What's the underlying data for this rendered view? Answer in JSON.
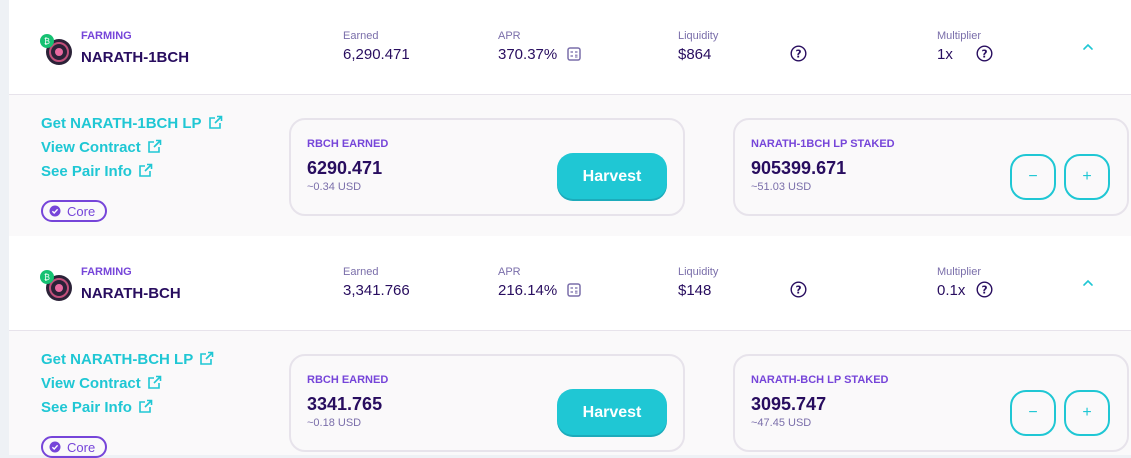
{
  "colors": {
    "primary": "#1fc7d4",
    "secondary": "#7645d9",
    "text": "#280d5f",
    "subtle": "#7a6eaa"
  },
  "farms": [
    {
      "farming_label": "FARMING",
      "pair": "NARATH-1BCH",
      "earned_label": "Earned",
      "earned": "6,290.471",
      "apr_label": "APR",
      "apr": "370.37%",
      "liquidity_label": "Liquidity",
      "liquidity": "$864",
      "multiplier_label": "Multiplier",
      "multiplier": "1x",
      "links": {
        "get_lp": "Get NARATH-1BCH LP",
        "contract": "View Contract",
        "pair_info": "See Pair Info"
      },
      "tag": "Core",
      "earned_card": {
        "title": "RBCH EARNED",
        "value": "6290.471",
        "usd": "~0.34 USD",
        "button": "Harvest"
      },
      "staked_card": {
        "title": "NARATH-1BCH LP STAKED",
        "value": "905399.671",
        "usd": "~51.03 USD",
        "minus": "−",
        "plus": "+"
      }
    },
    {
      "farming_label": "FARMING",
      "pair": "NARATH-BCH",
      "earned_label": "Earned",
      "earned": "3,341.766",
      "apr_label": "APR",
      "apr": "216.14%",
      "liquidity_label": "Liquidity",
      "liquidity": "$148",
      "multiplier_label": "Multiplier",
      "multiplier": "0.1x",
      "links": {
        "get_lp": "Get NARATH-BCH LP",
        "contract": "View Contract",
        "pair_info": "See Pair Info"
      },
      "tag": "Core",
      "earned_card": {
        "title": "RBCH EARNED",
        "value": "3341.765",
        "usd": "~0.18 USD",
        "button": "Harvest"
      },
      "staked_card": {
        "title": "NARATH-BCH LP STAKED",
        "value": "3095.747",
        "usd": "~47.45 USD",
        "minus": "−",
        "plus": "+"
      }
    }
  ]
}
